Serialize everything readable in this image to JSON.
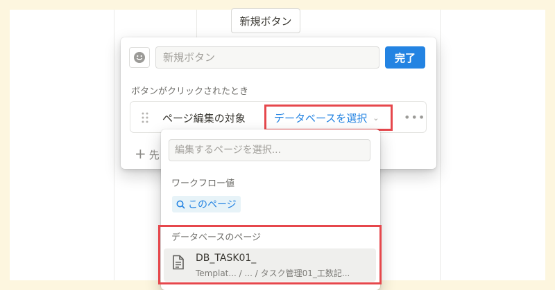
{
  "top_button_label": "新規ボタン",
  "panel": {
    "name_placeholder": "新規ボタン",
    "done_label": "完了",
    "section_label": "ボタンがクリックされたとき",
    "action_label": "ページ編集の対象",
    "target_select_label": "データベースを選択",
    "more_label": "•••",
    "add_icon": "+",
    "add_tail": "先"
  },
  "dropdown": {
    "search_placeholder": "編集するページを選択...",
    "workflow_header": "ワークフロー値",
    "this_page_label": "このページ",
    "db_pages_header": "データベースのページ",
    "item_title": "DB_TASK01_",
    "item_subtitle": "Templat...  / ... / タスク管理01_工数記..."
  },
  "colors": {
    "accent_blue": "#2383e2",
    "highlight_red": "#e6474c",
    "outer_bg": "#fdf6df"
  },
  "icons": [
    "emoji-face-icon",
    "drag-handle-icon",
    "chevron-down-icon",
    "more-dots-icon",
    "plus-icon",
    "search-icon",
    "document-icon"
  ]
}
